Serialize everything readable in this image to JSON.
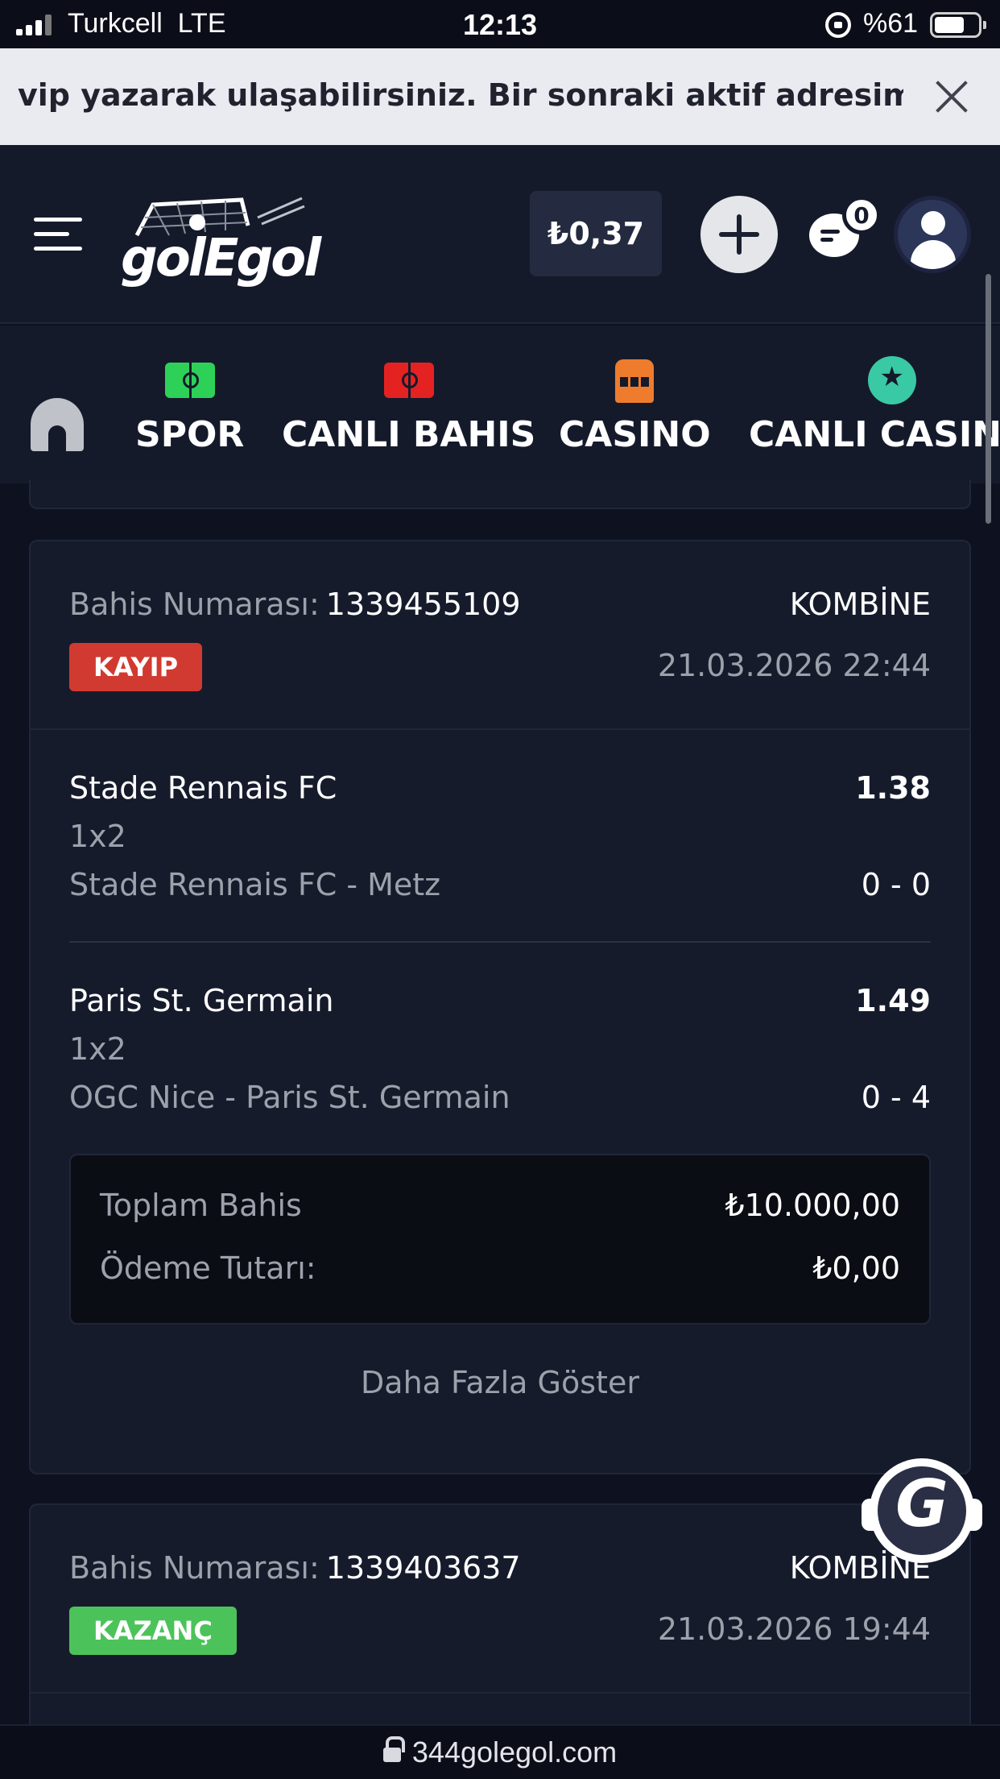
{
  "status_bar": {
    "carrier": "Turkcell",
    "network": "LTE",
    "time": "12:13",
    "battery": "%61"
  },
  "announcement": {
    "text": "vip yazarak ulaşabilirsiniz. Bir sonraki aktif adresimiz www"
  },
  "header": {
    "brand": "golEgol",
    "balance": "₺0,37",
    "chat_count": "0"
  },
  "nav": {
    "items": [
      {
        "label": "SPOR",
        "icon": "soccer-pitch-icon",
        "color": "#2ed158"
      },
      {
        "label": "CANLI BAHIS",
        "icon": "live-pitch-icon",
        "color": "#e52222"
      },
      {
        "label": "CASINO",
        "icon": "slot-machine-icon",
        "color": "#ee7c2c"
      },
      {
        "label": "CANLI CASINO",
        "icon": "casino-chip-icon",
        "color": "#39c9a4"
      }
    ]
  },
  "bets": [
    {
      "number_label": "Bahis Numarası:",
      "number": "1339455109",
      "type": "KOMBİNE",
      "status": "KAYIP",
      "status_color": "#d13a30",
      "date": "21.03.2026 22:44",
      "selections": [
        {
          "team": "Stade Rennais FC",
          "odds": "1.38",
          "market": "1x2",
          "match": "Stade Rennais FC - Metz",
          "score": "0 - 0"
        },
        {
          "team": "Paris St. Germain",
          "odds": "1.49",
          "market": "1x2",
          "match": "OGC Nice - Paris St. Germain",
          "score": "0 - 4"
        }
      ],
      "total_label": "Toplam Bahis",
      "total": "₺10.000,00",
      "payout_label": "Ödeme Tutarı:",
      "payout": "₺0,00",
      "more_label": "Daha Fazla Göster"
    },
    {
      "number_label": "Bahis Numarası:",
      "number": "1339403637",
      "type": "KOMBİNE",
      "status": "KAZANÇ",
      "status_color": "#4cc35a",
      "date": "21.03.2026 19:44"
    }
  ],
  "browser": {
    "url": "344golegol.com"
  }
}
